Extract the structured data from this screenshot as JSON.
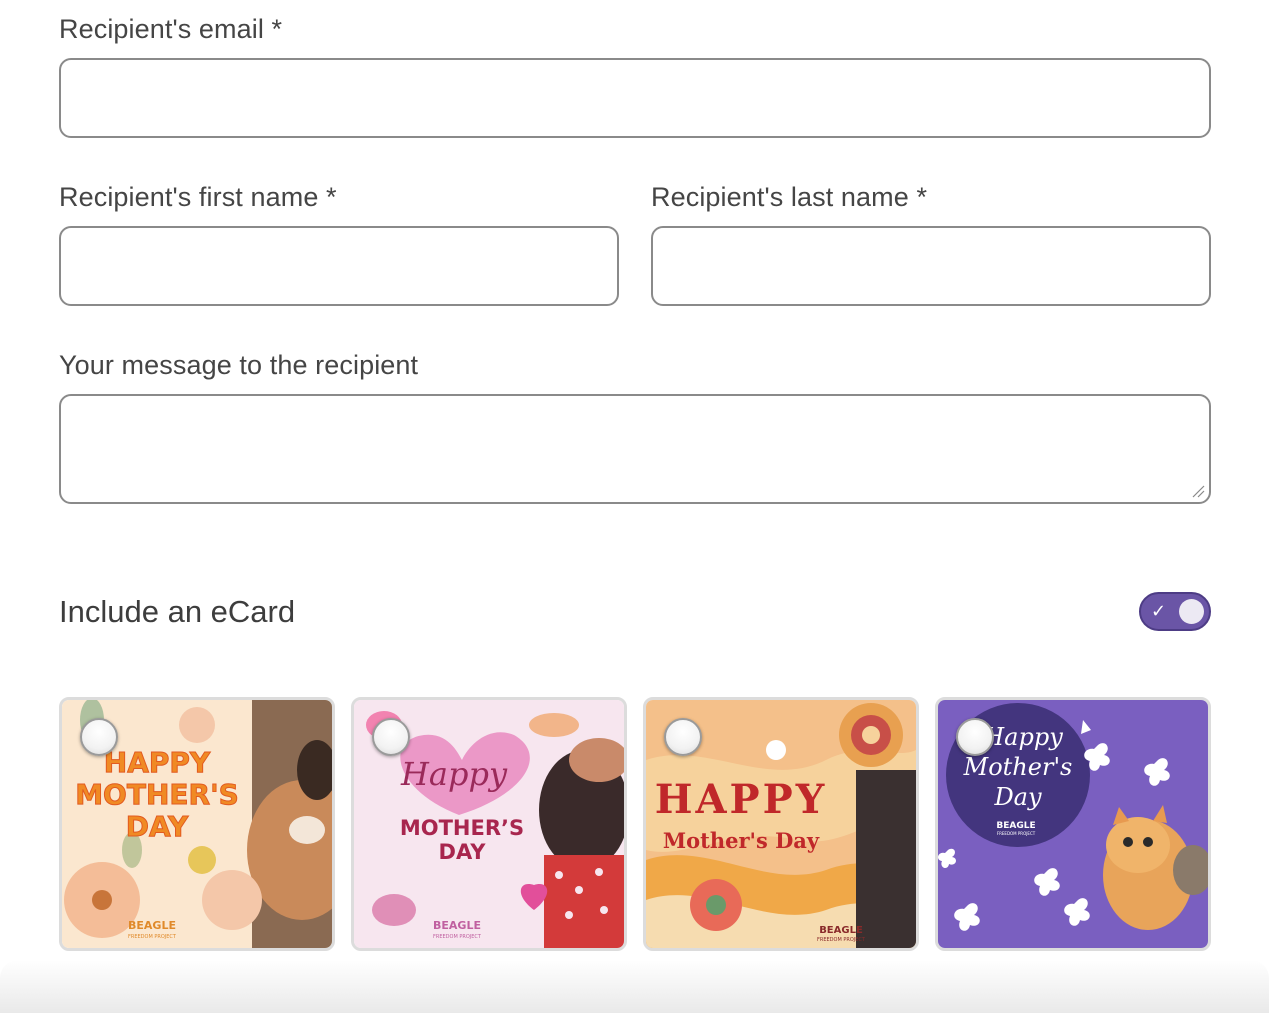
{
  "form": {
    "email_label": "Recipient's email *",
    "email_value": "",
    "first_name_label": "Recipient's first name *",
    "first_name_value": "",
    "last_name_label": "Recipient's last name *",
    "last_name_value": "",
    "message_label": "Your message to the recipient",
    "message_value": ""
  },
  "ecard": {
    "title": "Include an eCard",
    "toggle_on": true,
    "toggle_icon": "check-icon",
    "accent_color": "#6a55a6",
    "cards": [
      {
        "line1": "HAPPY",
        "line2": "MOTHER'S",
        "line3": "DAY",
        "brand": "BEAGLE",
        "brand_sub": "FREEDOM PROJECT",
        "selected": false
      },
      {
        "line1": "Happy",
        "line2": "MOTHER’S",
        "line3": "DAY",
        "brand": "BEAGLE",
        "brand_sub": "FREEDOM PROJECT",
        "selected": false
      },
      {
        "line1": "HAPPY",
        "line2": "Mother's Day",
        "brand": "BEAGLE",
        "brand_sub": "FREEDOM PROJECT",
        "selected": false
      },
      {
        "line1": "Happy",
        "line2": "Mother's",
        "line3": "Day",
        "brand": "BEAGLE",
        "brand_sub": "FREEDOM PROJECT",
        "selected": false
      }
    ]
  }
}
